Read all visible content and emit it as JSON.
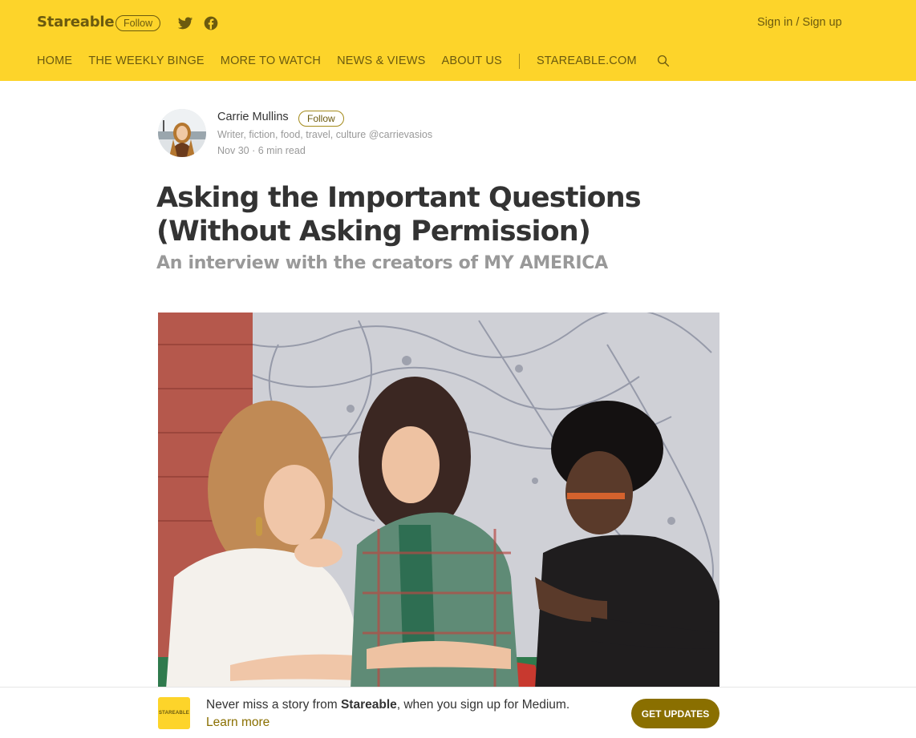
{
  "header": {
    "brand": "Stareable",
    "follow_label": "Follow",
    "signin_label": "Sign in / Sign up",
    "nav": [
      "HOME",
      "THE WEEKLY BINGE",
      "MORE TO WATCH",
      "NEWS & VIEWS",
      "ABOUT US"
    ],
    "site_link": "STAREABLE.COM",
    "colors": {
      "bar": "#fdd42a",
      "text": "#6b5a0f"
    }
  },
  "author": {
    "name": "Carrie Mullins",
    "follow_label": "Follow",
    "bio": "Writer, fiction, food, travel, culture @carrievasios",
    "date": "Nov 30",
    "read_time": "6 min read"
  },
  "article": {
    "title": "Asking the Important Questions (Without Asking Permission)",
    "subtitle": "An interview with the creators of MY AMERICA"
  },
  "banner": {
    "logo_text": "STAREABLE",
    "text_before": "Never miss a story from ",
    "publication": "Stareable",
    "text_after": ", when you sign up for Medium.",
    "learn_more": "Learn more",
    "cta": "GET UPDATES",
    "cta_color": "#8a6f00"
  }
}
